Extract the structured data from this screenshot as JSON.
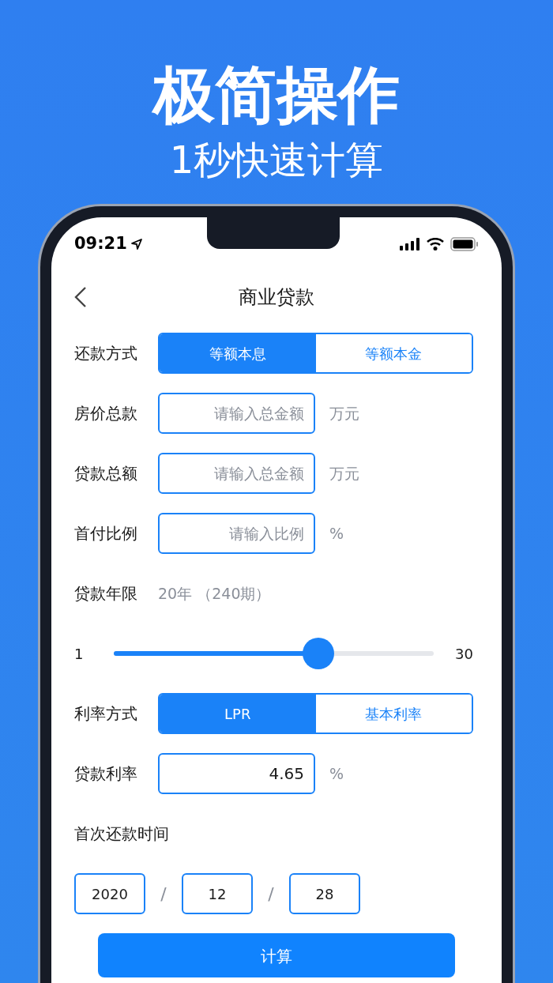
{
  "headline": "极简操作",
  "subheadline": "1秒快速计算",
  "status_bar": {
    "time": "09:21"
  },
  "nav": {
    "title": "商业贷款"
  },
  "rows": [
    {
      "kind": "segmented",
      "label": "还款方式",
      "options": [
        {
          "label": "等额本息",
          "selected": true
        },
        {
          "label": "等额本金",
          "selected": false
        }
      ]
    },
    {
      "kind": "input",
      "label": "房价总款",
      "placeholder": "请输入总金额",
      "unit": "万元"
    },
    {
      "kind": "input",
      "label": "贷款总额",
      "placeholder": "请输入总金额",
      "unit": "万元"
    },
    {
      "kind": "input",
      "label": "首付比例",
      "placeholder": "请输入比例",
      "unit": "%"
    },
    {
      "kind": "info",
      "label": "贷款年限",
      "value": "20年 （240期）"
    },
    {
      "kind": "slider",
      "min": "1",
      "max": "30",
      "level": 0.64
    },
    {
      "kind": "segmented",
      "label": "利率方式",
      "options": [
        {
          "label": "LPR",
          "selected": true
        },
        {
          "label": "基本利率",
          "selected": false
        }
      ]
    },
    {
      "kind": "input",
      "label": "贷款利率",
      "value": "4.65",
      "unit": "%"
    },
    {
      "kind": "info",
      "label": "首次还款时间"
    },
    {
      "kind": "date",
      "parts": [
        {
          "value": "2020"
        },
        {
          "value": "12"
        },
        {
          "value": "28"
        }
      ],
      "separators": [
        "/",
        "/"
      ]
    }
  ],
  "button": {
    "label": "计算"
  }
}
